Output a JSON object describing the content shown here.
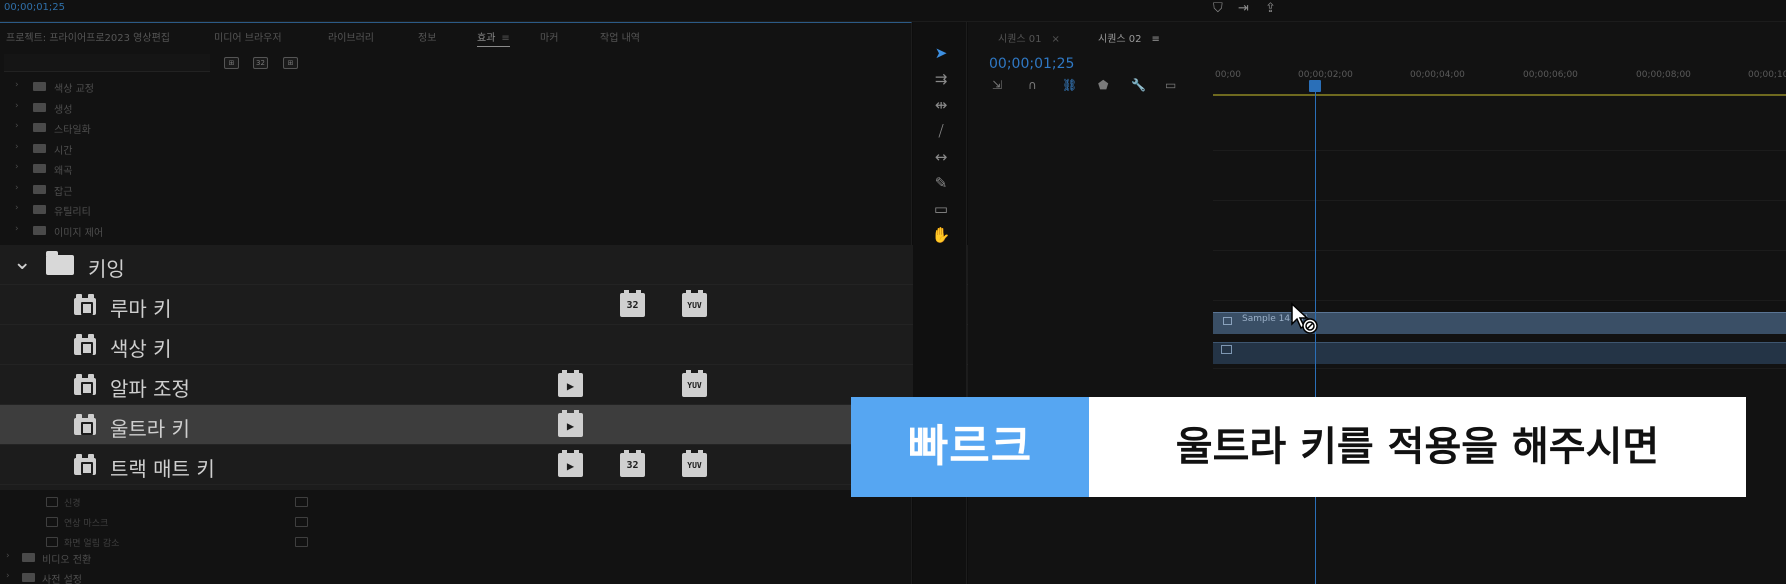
{
  "top_bar": {
    "timecode": "00;00;01;25"
  },
  "effects_panel": {
    "tabs": [
      {
        "label": "프로젝트: 프라이어프로2023 영상편집"
      },
      {
        "label": "미디어 브라우저"
      },
      {
        "label": "라이브러리"
      },
      {
        "label": "정보"
      },
      {
        "label": "효과",
        "active": true
      },
      {
        "label": "마커"
      },
      {
        "label": "작업 내역"
      }
    ],
    "search": {
      "value": "",
      "placeholder": ""
    },
    "header_badges": [
      "⊞",
      "32",
      "⊞"
    ],
    "categories": [
      {
        "label": "색상 교정"
      },
      {
        "label": "생성"
      },
      {
        "label": "스타일화"
      },
      {
        "label": "시간"
      },
      {
        "label": "왜곡"
      },
      {
        "label": "잡근"
      },
      {
        "label": "유틸리티"
      },
      {
        "label": "이미지 제어"
      }
    ],
    "keying_folder": {
      "label": "키잉",
      "items": [
        {
          "label": "루마 키",
          "acc": false,
          "b32": true,
          "yuv": true
        },
        {
          "label": "색상 키",
          "acc": false,
          "b32": false,
          "yuv": false
        },
        {
          "label": "알파 조정",
          "acc": true,
          "b32": false,
          "yuv": true
        },
        {
          "label": "울트라 키",
          "acc": true,
          "b32": false,
          "yuv": false,
          "selected": true
        },
        {
          "label": "트랙 매트 키",
          "acc": true,
          "b32": true,
          "yuv": true
        }
      ],
      "badge_text": {
        "acc": "▶",
        "b32": "32",
        "yuv": "YUV"
      }
    },
    "lower_items": [
      {
        "label": "신경"
      },
      {
        "label": "연상 마스크"
      },
      {
        "label": "화면 얼림 감소"
      }
    ],
    "lower_folders": [
      {
        "label": "비디오 전환"
      },
      {
        "label": "사전 설정"
      }
    ]
  },
  "sequence_panel": {
    "tabs": [
      {
        "label": "시퀀스 01",
        "active": false
      },
      {
        "label": "시퀀스 02",
        "active": true
      }
    ],
    "timecode": "00;00;01;25",
    "ruler_labels": [
      "00;00",
      "00;00;02;00",
      "00;00;04;00",
      "00;00;06;00",
      "00;00;08;00",
      "00;00;10"
    ],
    "clip_label": "Sample 14...V)"
  },
  "caption": {
    "tag": "빠르크",
    "text": "울트라 키를 적용을 해주시면"
  },
  "colors": {
    "accent_blue": "#56a6f2",
    "timecode_blue": "#2f78c4",
    "clip_blue": "#3a4f66"
  }
}
